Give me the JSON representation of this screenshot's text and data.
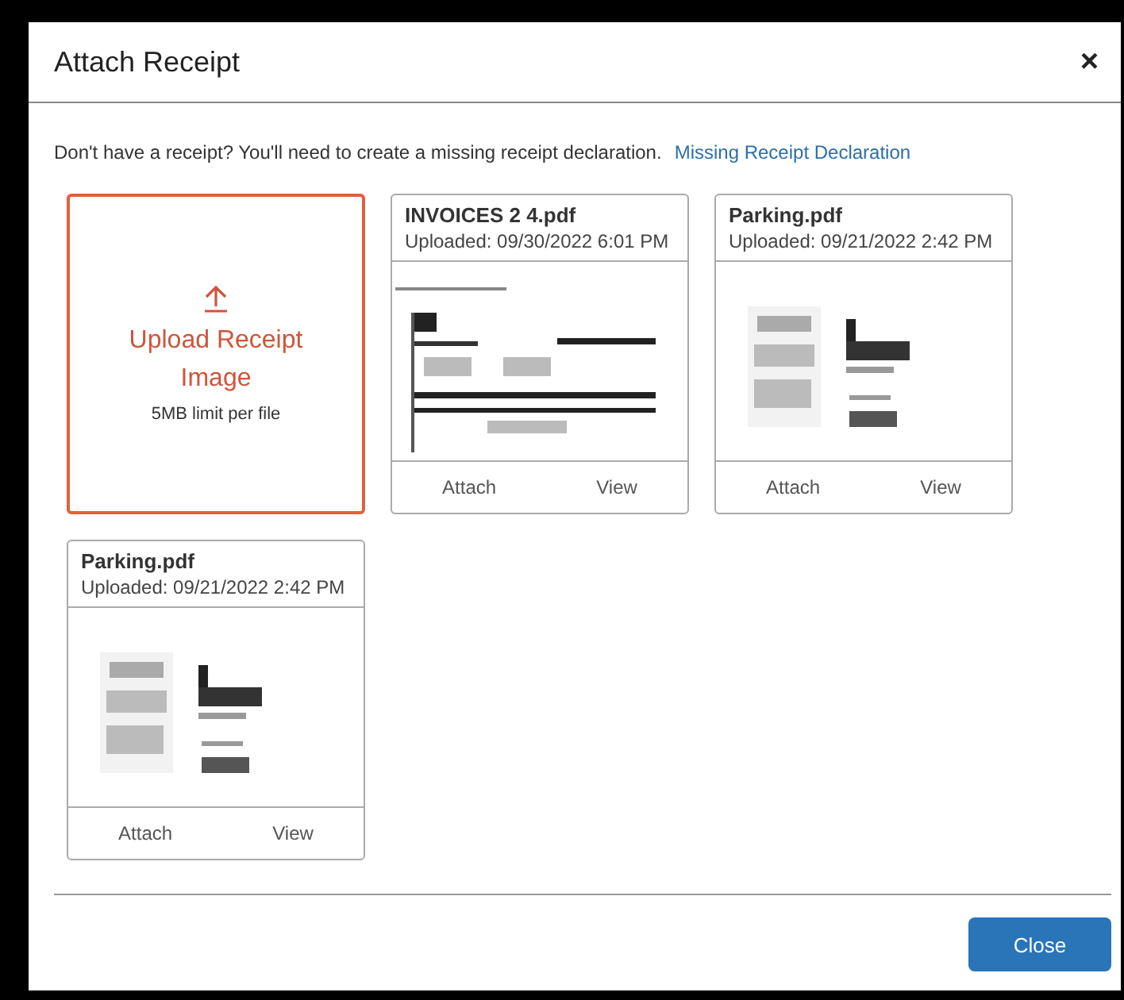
{
  "dialog": {
    "title": "Attach Receipt",
    "close_icon": "×"
  },
  "notice": {
    "text": "Don't have a receipt? You'll need to create a missing receipt declaration.",
    "link": "Missing Receipt Declaration"
  },
  "upload": {
    "label": "Upload Receipt Image",
    "hint": "5MB limit per file"
  },
  "receipts": [
    {
      "name": "INVOICES 2 4.pdf",
      "uploaded": "Uploaded: 09/30/2022 6:01 PM",
      "actions": [
        "Attach",
        "View"
      ]
    },
    {
      "name": "Parking.pdf",
      "uploaded": "Uploaded: 09/21/2022 2:42 PM",
      "actions": [
        "Attach",
        "View"
      ]
    },
    {
      "name": "Parking.pdf",
      "uploaded": "Uploaded: 09/21/2022 2:42 PM",
      "actions": [
        "Attach",
        "View"
      ]
    }
  ],
  "footer": {
    "button": "Close"
  }
}
